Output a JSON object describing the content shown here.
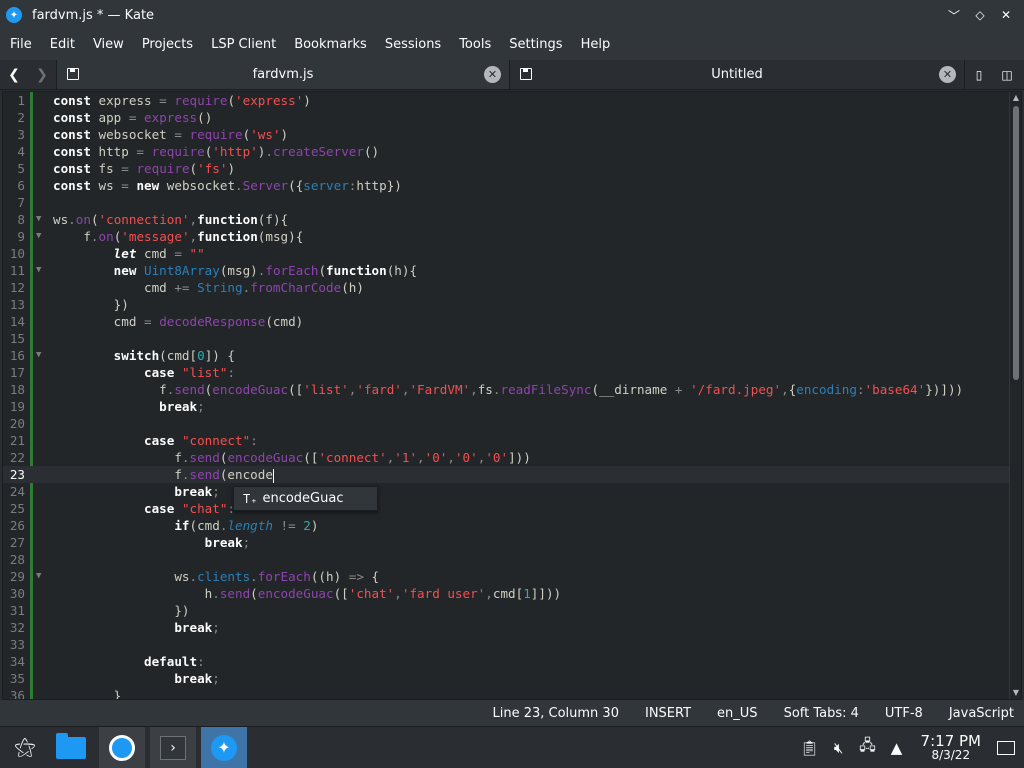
{
  "window": {
    "title": "fardvm.js * — Kate",
    "controls": [
      "minimize",
      "restore",
      "close"
    ]
  },
  "menu": [
    "File",
    "Edit",
    "View",
    "Projects",
    "LSP Client",
    "Bookmarks",
    "Sessions",
    "Tools",
    "Settings",
    "Help"
  ],
  "tabs": [
    {
      "label": "fardvm.js",
      "active": true
    },
    {
      "label": "Untitled",
      "active": false
    }
  ],
  "editor": {
    "current_line": 23,
    "lines": [
      {
        "n": "1",
        "fold": "",
        "html": "<span class=\"kw\">const</span> express <span class=\"op\">=</span> <span class=\"fn\">require</span>(<span class=\"str\">'express'</span>)"
      },
      {
        "n": "2",
        "fold": "",
        "html": "<span class=\"kw\">const</span> app <span class=\"op\">=</span> <span class=\"fn\">express</span>()"
      },
      {
        "n": "3",
        "fold": "",
        "html": "<span class=\"kw\">const</span> websocket <span class=\"op\">=</span> <span class=\"fn\">require</span>(<span class=\"str\">'ws'</span>)"
      },
      {
        "n": "4",
        "fold": "",
        "html": "<span class=\"kw\">const</span> http <span class=\"op\">=</span> <span class=\"fn\">require</span>(<span class=\"str\">'http'</span>)<span class=\"op\">.</span><span class=\"fn\">createServer</span>()"
      },
      {
        "n": "5",
        "fold": "",
        "html": "<span class=\"kw\">const</span> fs <span class=\"op\">=</span> <span class=\"fn\">require</span>(<span class=\"str\">'fs'</span>)"
      },
      {
        "n": "6",
        "fold": "",
        "html": "<span class=\"kw\">const</span> ws <span class=\"op\">=</span> <span class=\"kw\">new</span> websocket<span class=\"op\">.</span><span class=\"fn\">Server</span>({<span class=\"prop\">server</span><span class=\"op\">:</span>http})"
      },
      {
        "n": "7",
        "fold": "",
        "html": ""
      },
      {
        "n": "8",
        "fold": "▼",
        "html": "ws<span class=\"op\">.</span><span class=\"fn\">on</span>(<span class=\"str\">'connection'</span><span class=\"op\">,</span><span class=\"kw\">function</span>(f){"
      },
      {
        "n": "9",
        "fold": "▼",
        "html": "    f<span class=\"op\">.</span><span class=\"fn\">on</span>(<span class=\"str\">'message'</span><span class=\"op\">,</span><span class=\"kw\">function</span>(msg){"
      },
      {
        "n": "10",
        "fold": "",
        "html": "        <span class=\"kw\"><i>let</i></span> cmd <span class=\"op\">=</span> <span class=\"str\">\"\"</span>"
      },
      {
        "n": "11",
        "fold": "▼",
        "html": "        <span class=\"kw\">new</span> <span class=\"prop\">Uint8Array</span>(msg)<span class=\"op\">.</span><span class=\"fn\">forEach</span>(<span class=\"kw\">function</span>(h){"
      },
      {
        "n": "12",
        "fold": "",
        "html": "            cmd <span class=\"op\">+=</span> <span class=\"prop\">String</span><span class=\"op\">.</span><span class=\"fn\">fromCharCode</span>(h)"
      },
      {
        "n": "13",
        "fold": "",
        "html": "        })"
      },
      {
        "n": "14",
        "fold": "",
        "html": "        cmd <span class=\"op\">=</span> <span class=\"fn\">decodeResponse</span>(cmd)"
      },
      {
        "n": "15",
        "fold": "",
        "html": ""
      },
      {
        "n": "16",
        "fold": "▼",
        "html": "        <span class=\"kw\">switch</span>(cmd[<span class=\"lit\">0</span>]) {"
      },
      {
        "n": "17",
        "fold": "",
        "html": "            <span class=\"kw\">case</span> <span class=\"str\">\"list\"</span><span class=\"op\">:</span>"
      },
      {
        "n": "18",
        "fold": "",
        "html": "              f<span class=\"op\">.</span><span class=\"fn\">send</span>(<span class=\"fn\">encodeGuac</span>([<span class=\"str\">'list'</span><span class=\"op\">,</span><span class=\"str\">'fard'</span><span class=\"op\">,</span><span class=\"str\">'FardVM'</span><span class=\"op\">,</span>fs<span class=\"op\">.</span><span class=\"fn\">readFileSync</span>(__dirname <span class=\"op\">+</span> <span class=\"str\">'/fard.jpeg'</span><span class=\"op\">,</span>{<span class=\"prop\">encoding</span><span class=\"op\">:</span><span class=\"str\">'base64'</span>})]))"
      },
      {
        "n": "19",
        "fold": "",
        "html": "              <span class=\"kw\">break</span><span class=\"op\">;</span>"
      },
      {
        "n": "20",
        "fold": "",
        "html": ""
      },
      {
        "n": "21",
        "fold": "",
        "html": "            <span class=\"kw\">case</span> <span class=\"str\">\"connect\"</span><span class=\"op\">:</span>"
      },
      {
        "n": "22",
        "fold": "",
        "html": "                f<span class=\"op\">.</span><span class=\"fn\">send</span>(<span class=\"fn\">encodeGuac</span>([<span class=\"str\">'connect'</span><span class=\"op\">,</span><span class=\"str\">'1'</span><span class=\"op\">,</span><span class=\"str\">'0'</span><span class=\"op\">,</span><span class=\"str\">'0'</span><span class=\"op\">,</span><span class=\"str\">'0'</span>]))"
      },
      {
        "n": "23",
        "fold": "",
        "html": "                f<span class=\"op\">.</span><span class=\"fn\">send</span>(encode<span class=\"caret\"></span>"
      },
      {
        "n": "24",
        "fold": "",
        "html": "                <span class=\"kw\">break</span><span class=\"op\">;</span>"
      },
      {
        "n": "25",
        "fold": "",
        "html": "            <span class=\"kw\">case</span> <span class=\"str\">\"chat\"</span><span class=\"op\">:</span>"
      },
      {
        "n": "26",
        "fold": "",
        "html": "                <span class=\"kw\">if</span>(cmd<span class=\"op\">.</span><span class=\"prop\"><i>length</i></span> <span class=\"op\">!=</span> <span class=\"lit\">2</span>)"
      },
      {
        "n": "27",
        "fold": "",
        "html": "                    <span class=\"kw\">break</span><span class=\"op\">;</span>"
      },
      {
        "n": "28",
        "fold": "",
        "html": ""
      },
      {
        "n": "29",
        "fold": "▼",
        "html": "                ws<span class=\"op\">.</span><span class=\"prop\">clients</span><span class=\"op\">.</span><span class=\"fn\">forEach</span>((h) <span class=\"op\">=></span> {"
      },
      {
        "n": "30",
        "fold": "",
        "html": "                    h<span class=\"op\">.</span><span class=\"fn\">send</span>(<span class=\"fn\">encodeGuac</span>([<span class=\"str\">'chat'</span><span class=\"op\">,</span><span class=\"str\">'fard user'</span><span class=\"op\">,</span>cmd[<span class=\"lit\">1</span>]]))"
      },
      {
        "n": "31",
        "fold": "",
        "html": "                })"
      },
      {
        "n": "32",
        "fold": "",
        "html": "                <span class=\"kw\">break</span><span class=\"op\">;</span>"
      },
      {
        "n": "33",
        "fold": "",
        "html": ""
      },
      {
        "n": "34",
        "fold": "",
        "html": "            <span class=\"kw\">default</span><span class=\"op\">:</span>"
      },
      {
        "n": "35",
        "fold": "",
        "html": "                <span class=\"kw\">break</span><span class=\"op\">;</span>"
      },
      {
        "n": "36",
        "fold": "",
        "html": "        }"
      }
    ]
  },
  "autocomplete": {
    "icon": "T₊",
    "label": "encodeGuac"
  },
  "statusbar": {
    "position": "Line 23, Column 30",
    "mode": "INSERT",
    "dictionary": "en_US",
    "indent": "Soft Tabs: 4",
    "encoding": "UTF-8",
    "syntax": "JavaScript"
  },
  "taskbar": {
    "apps": [
      "application-launcher",
      "file-manager",
      "chromium",
      "terminal",
      "kate"
    ],
    "clock": {
      "time": "7:17 PM",
      "date": "8/3/22"
    }
  }
}
